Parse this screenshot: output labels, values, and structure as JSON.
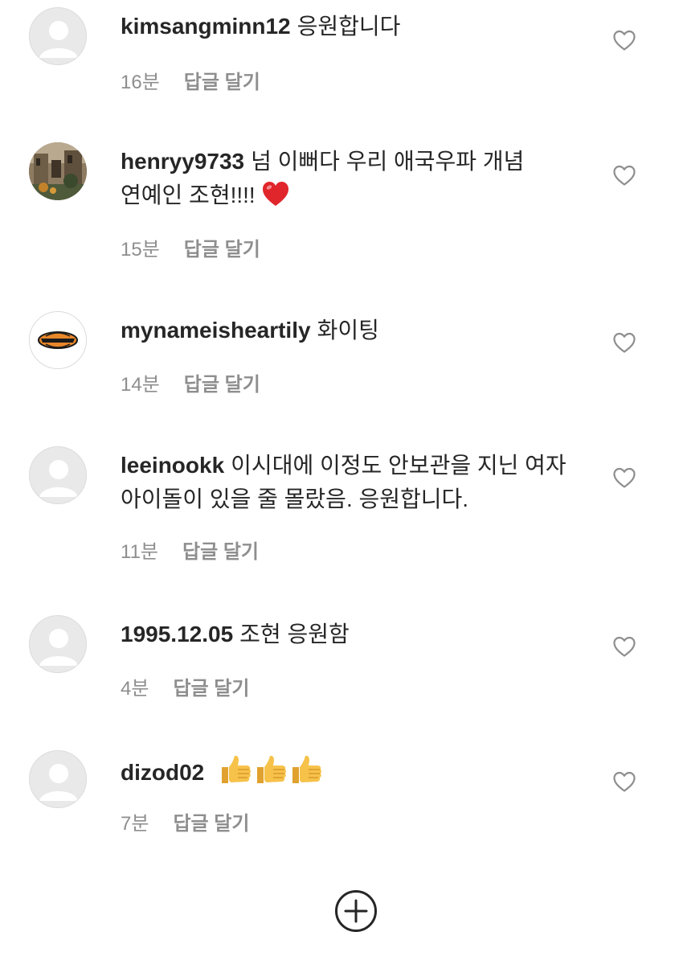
{
  "comments": [
    {
      "username": "kimsangminn12",
      "text": "응원합니다",
      "time": "16분",
      "reply_label": "답글 달기",
      "avatar": "default-avatar-icon"
    },
    {
      "username": "henryy9733",
      "text": "넘 이뻐다 우리 애국우파 개념 연예인 조현!!!!",
      "emoji": "red-heart",
      "time": "15분",
      "reply_label": "답글 달기",
      "avatar": "photo-avatar"
    },
    {
      "username": "mynameisheartily",
      "text": "화이팅",
      "time": "14분",
      "reply_label": "답글 달기",
      "avatar": "logo-avatar"
    },
    {
      "username": "leeinookk",
      "text": "이시대에 이정도 안보관을 지닌 여자 아이돌이 있을 줄 몰랐음. 응원합니다.",
      "time": "11분",
      "reply_label": "답글 달기",
      "avatar": "default-avatar-icon"
    },
    {
      "username": "1995.12.05",
      "text": "조현 응원함",
      "time": "4분",
      "reply_label": "답글 달기",
      "avatar": "default-avatar-icon"
    },
    {
      "username": "dizod02",
      "text": "",
      "emoji": "thumbs-up x3",
      "time": "7분",
      "reply_label": "답글 달기",
      "avatar": "default-avatar-icon"
    }
  ],
  "icons": {
    "like": "heart-outline-icon",
    "load_more": "plus-circle-icon"
  },
  "colors": {
    "text": "#262626",
    "meta": "#8e8e8e",
    "heart_red": "#e0262b",
    "thumbs": "#f4b63c"
  }
}
